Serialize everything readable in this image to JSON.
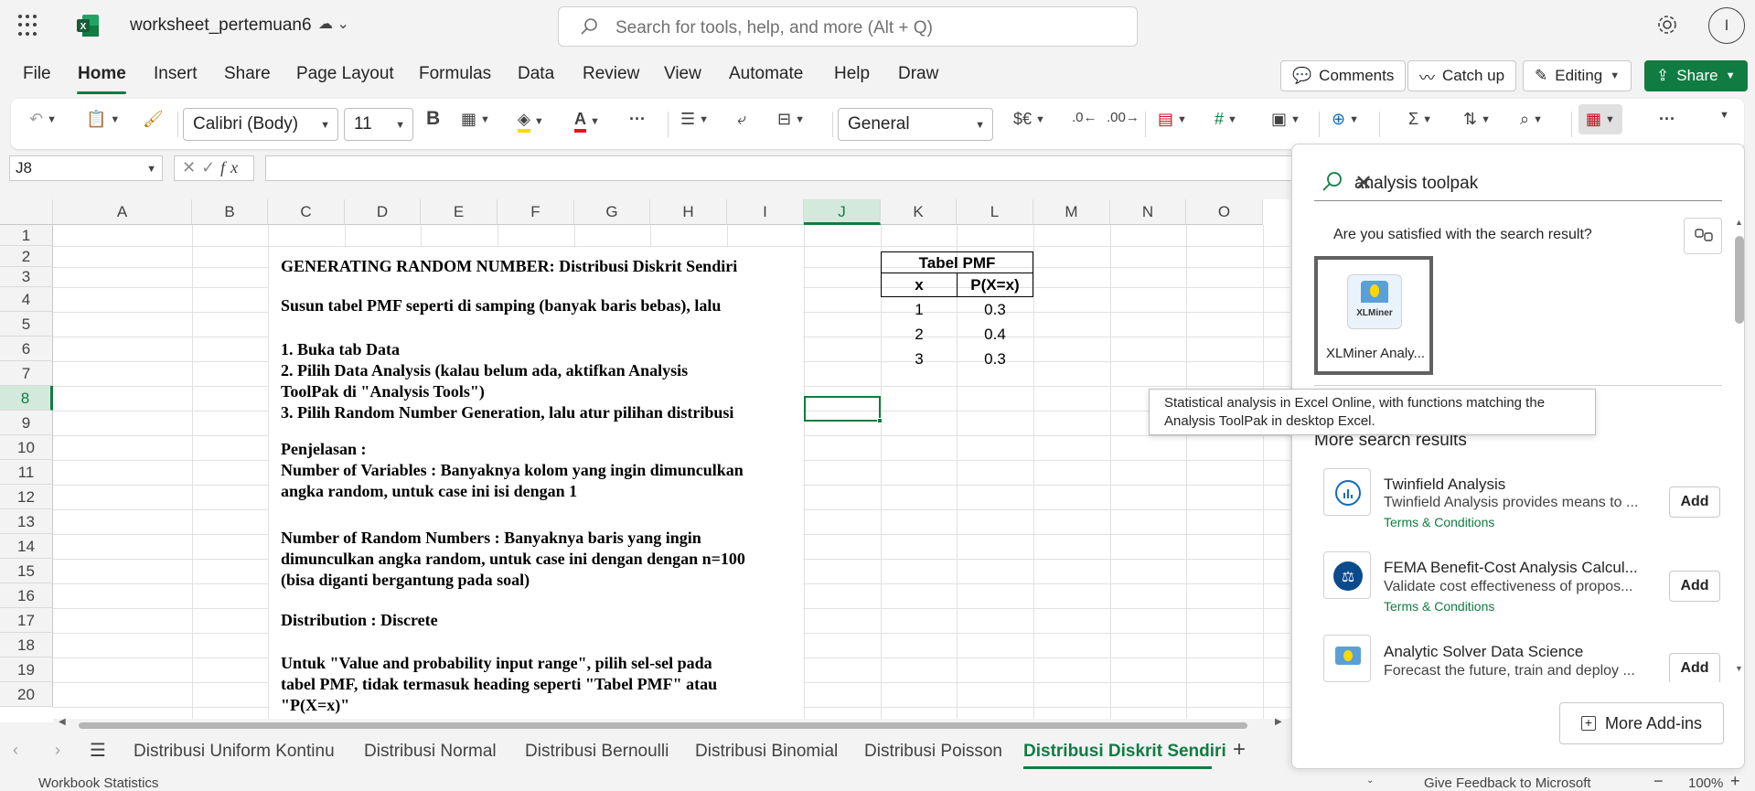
{
  "app": {
    "doc_title": "worksheet_pertemuan6",
    "search_placeholder": "Search for tools, help, and more (Alt + Q)",
    "avatar_initial": "I"
  },
  "menu": {
    "items": [
      "File",
      "Home",
      "Insert",
      "Share",
      "Page Layout",
      "Formulas",
      "Data",
      "Review",
      "View",
      "Automate",
      "Help",
      "Draw"
    ],
    "active": "Home",
    "comments": "Comments",
    "catch_up": "Catch up",
    "editing": "Editing",
    "share": "Share"
  },
  "ribbon": {
    "font_name": "Calibri (Body)",
    "font_size": "11",
    "bold": "B",
    "number_format": "General",
    "currency": "$€",
    "font_color": "#e81123",
    "highlight_color": "#ffd800"
  },
  "formula_bar": {
    "name_box": "J8",
    "fx": "fx",
    "formula": ""
  },
  "grid": {
    "columns": [
      "A",
      "B",
      "C",
      "D",
      "E",
      "F",
      "G",
      "H",
      "I",
      "J",
      "K",
      "L",
      "M",
      "N",
      "O"
    ],
    "selected_column": "J",
    "rows": [
      "1",
      "2",
      "3",
      "4",
      "5",
      "6",
      "7",
      "8",
      "9",
      "10",
      "11",
      "12",
      "13",
      "14",
      "15",
      "16",
      "17",
      "18",
      "19",
      "20"
    ],
    "selected_row": "8",
    "text_lines": [
      "GENERATING RANDOM NUMBER: Distribusi Diskrit Sendiri",
      "Susun tabel PMF seperti di samping (banyak baris bebas), lalu",
      "1. Buka tab Data",
      "2. Pilih Data Analysis (kalau belum ada, aktifkan Analysis",
      "ToolPak di \"Analysis Tools\")",
      "3. Pilih Random Number Generation, lalu atur pilihan distribusi",
      "Penjelasan :",
      "Number of Variables : Banyaknya kolom yang ingin dimunculkan",
      "angka random, untuk case ini isi dengan 1",
      "Number of Random Numbers : Banyaknya baris yang ingin",
      "dimunculkan angka random, untuk case ini dengan dengan n=100",
      "(bisa diganti bergantung pada soal)",
      "Distribution : Discrete",
      "Untuk \"Value and probability input range\", pilih sel-sel pada",
      "tabel PMF, tidak termasuk heading seperti \"Tabel PMF\" atau",
      "\"P(X=x)\""
    ],
    "pmf": {
      "title": "Tabel PMF",
      "headers": [
        "x",
        "P(X=x)"
      ],
      "rows": [
        [
          "1",
          "0.3"
        ],
        [
          "2",
          "0.4"
        ],
        [
          "3",
          "0.3"
        ]
      ]
    }
  },
  "sheets": {
    "tabs": [
      "Distribusi Uniform Kontinu",
      "Distribusi Normal",
      "Distribusi Bernoulli",
      "Distribusi Binomial",
      "Distribusi Poisson",
      "Distribusi Diskrit Sendiri"
    ],
    "active": "Distribusi Diskrit Sendiri"
  },
  "status": {
    "left": "Workbook Statistics",
    "feedback": "Give Feedback to Microsoft",
    "zoom": "100%"
  },
  "panel": {
    "query": "analysis toolpak",
    "satisfied": "Are you satisfied with the search result?",
    "top_result": {
      "name": "XLMiner Analy...",
      "logo_text": "XLMiner"
    },
    "tooltip": "Statistical analysis in Excel Online, with functions matching the Analysis ToolPak in desktop Excel.",
    "more_title": "More search results",
    "results": [
      {
        "title": "Twinfield Analysis",
        "desc": "Twinfield Analysis provides means to ...",
        "terms": "Terms & Conditions",
        "add": "Add"
      },
      {
        "title": "FEMA Benefit-Cost Analysis Calcul...",
        "desc": "Validate cost effectiveness of propos...",
        "terms": "Terms & Conditions",
        "add": "Add"
      },
      {
        "title": "Analytic Solver Data Science",
        "desc": "Forecast the future, train and deploy ...",
        "terms": "",
        "add": "Add"
      }
    ],
    "more_addins": "More Add-ins"
  }
}
